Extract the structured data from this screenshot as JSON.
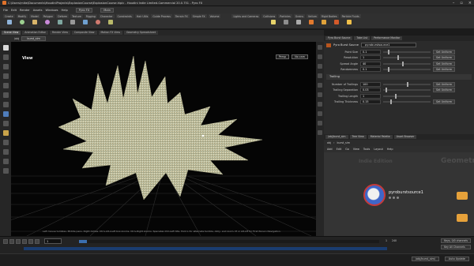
{
  "window": {
    "title": "C:\\Users\\mike\\Documents\\HoudiniProjects\\ExplosionCourse\\ExplosionCourse.hiplc - Houdini Indie Limited-Commercial 20.0.751 - Pyro FX"
  },
  "menubar": {
    "items": [
      "File",
      "Edit",
      "Render",
      "Assets",
      "Windows",
      "Help"
    ],
    "desktop": "Pyro FX",
    "build": "Main"
  },
  "shelf": {
    "tabs": [
      "Create",
      "Modify",
      "Model",
      "Polygon",
      "Deform",
      "Texture",
      "Rigging",
      "Character",
      "Constraints",
      "Hair Utils",
      "Guide Process",
      "Terrain FX",
      "Simple FX",
      "Volume"
    ],
    "right_tabs": [
      "Lights and Cameras",
      "Collisions",
      "Particles",
      "Grains",
      "Vellum",
      "Rigid Bodies",
      "Particle Fluids",
      "Viscous Fluids",
      "Oceans",
      "Pyro FX",
      "FEM",
      "Wires",
      "Crowds",
      "Drive Simulation"
    ]
  },
  "left_panel_tabs": [
    "Scene View",
    "Animation Editor",
    "Render View",
    "Composite View",
    "Motion FX View",
    "Geometry Spreadsheet"
  ],
  "viewport": {
    "object_path": "/obj",
    "object": "burst_sim",
    "label": "View",
    "camera": "Persp",
    "cam_menu": "No cam",
    "hint": "Left mouse tumbles. Middle pans. Right dollies. Ctrl+Alt+Left box-zooms. Ctrl+Right zooms. Spacebar-Ctrl-Left tilts. Hold L for alternate tumble, dolly, and zoom. M or Alt+M for First Person Navigation."
  },
  "params": {
    "tabs": [
      "Pyro Burst Source",
      "Take List",
      "Performance Monitor"
    ],
    "node_type": "Pyro Burst Source",
    "node_name": "pyroburstsource1",
    "rows": [
      {
        "label": "Point Size",
        "value": "0.1",
        "set": "Set Uniform"
      },
      {
        "label": "Resolution",
        "value": "1",
        "set": "Set Uniform"
      },
      {
        "label": "Spread Angle",
        "value": "40",
        "set": "Set Uniform"
      },
      {
        "label": "Randomness",
        "value": "0.1",
        "set": "Set Uniform"
      }
    ],
    "section": "Trailing",
    "trailing_rows": [
      {
        "label": "Number of Trailings",
        "value": "100",
        "set": "Set Uniform"
      },
      {
        "label": "Trailing Separation",
        "value": "0.03",
        "set": "Set Uniform"
      },
      {
        "label": "Trailing Length",
        "value": "1",
        "set": ""
      },
      {
        "label": "Trailing Thickness",
        "value": "0.15",
        "set": "Set Uniform"
      }
    ]
  },
  "network": {
    "tabs": [
      "/obj/burst_sim",
      "Tree View",
      "Material Palette",
      "Asset Browser"
    ],
    "path": [
      "obj",
      "burst_sim"
    ],
    "menu": [
      "Add",
      "Edit",
      "Go",
      "View",
      "Tools",
      "Layout",
      "Help"
    ],
    "watermark_left": "Indie Edition",
    "watermark_right": "Geometry",
    "node_label": "pyroburstsource1"
  },
  "timeline": {
    "frame": "1",
    "end_a": "1",
    "end_b": "240",
    "end_label_a": "1",
    "end_label_b": "240",
    "btn1": "Keys, 0/0 channels",
    "btn2": "Key All Channels"
  },
  "status": {
    "scene": "/obj/burst_sim/",
    "update": "Auto Update"
  }
}
